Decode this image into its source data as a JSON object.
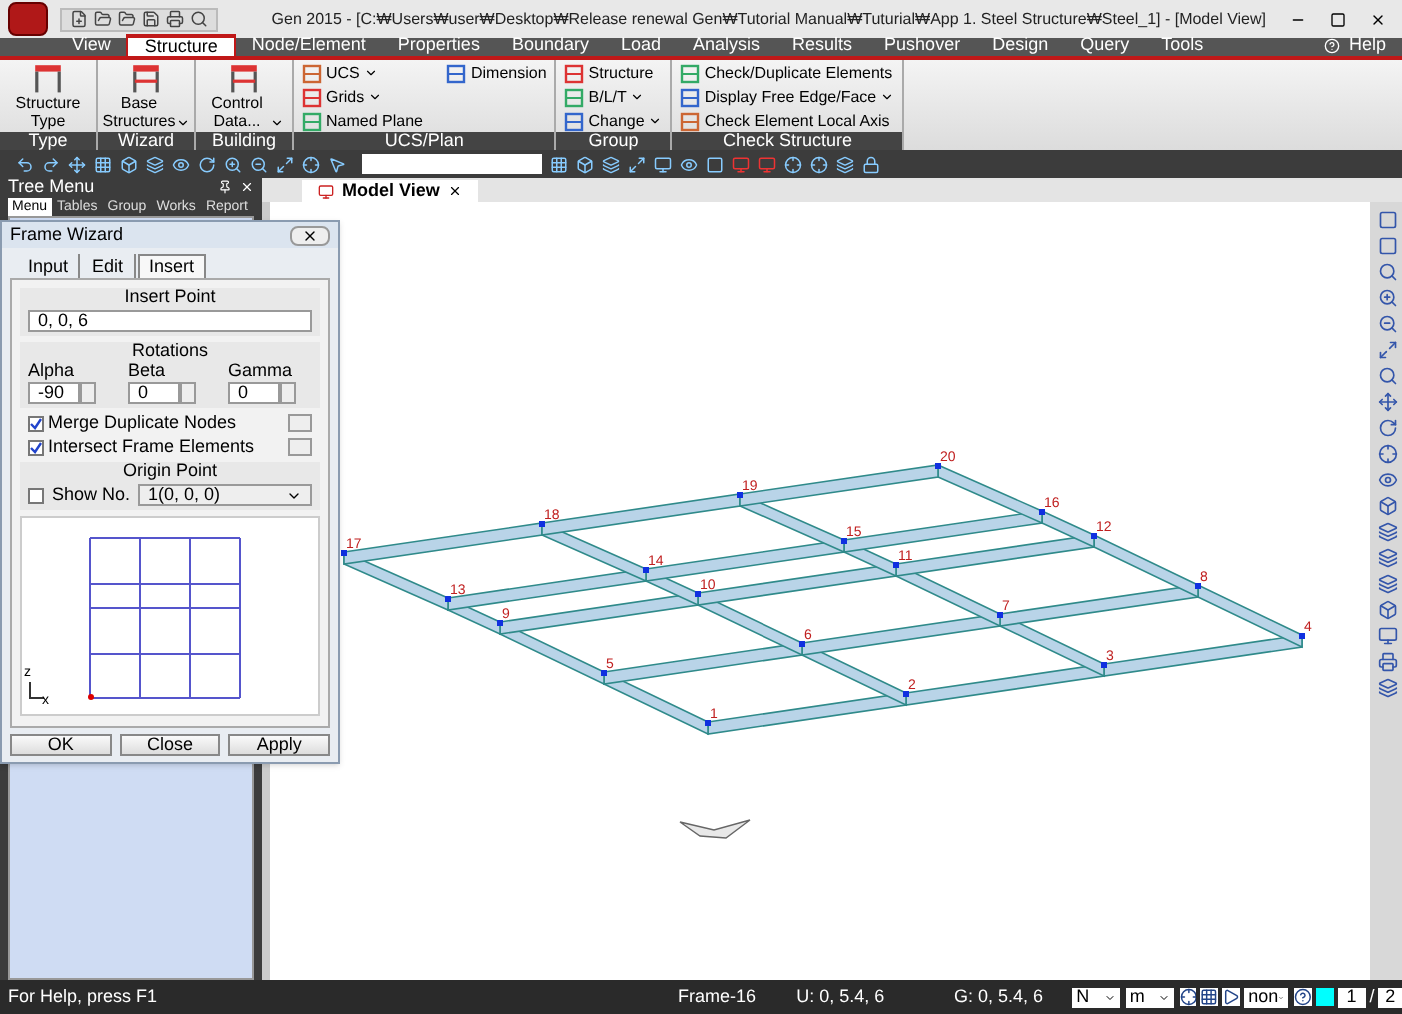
{
  "window": {
    "title": "Gen 2015 - [C:₩Users₩user₩Desktop₩Release renewal Gen₩Tutorial Manual₩Tuturial₩App 1. Steel Structure₩Steel_1] - [Model View]"
  },
  "menu_tabs": [
    {
      "label": "View",
      "selected": false
    },
    {
      "label": "Structure",
      "selected": true
    },
    {
      "label": "Node/Element",
      "selected": false
    },
    {
      "label": "Properties",
      "selected": false
    },
    {
      "label": "Boundary",
      "selected": false
    },
    {
      "label": "Load",
      "selected": false
    },
    {
      "label": "Analysis",
      "selected": false
    },
    {
      "label": "Results",
      "selected": false
    },
    {
      "label": "Pushover",
      "selected": false
    },
    {
      "label": "Design",
      "selected": false
    },
    {
      "label": "Query",
      "selected": false
    },
    {
      "label": "Tools",
      "selected": false
    }
  ],
  "help": "Help",
  "ribbon_groups": [
    {
      "title": "Type",
      "items": [
        {
          "kind": "large",
          "label": "Structure Type",
          "dropdown": false
        }
      ]
    },
    {
      "title": "Wizard",
      "items": [
        {
          "kind": "large",
          "label": "Base Structures",
          "dropdown": true
        }
      ]
    },
    {
      "title": "Building",
      "items": [
        {
          "kind": "large",
          "label": "Control Data...",
          "dropdown": true
        }
      ]
    },
    {
      "title": "UCS/Plan",
      "items": [
        {
          "kind": "small",
          "label": "UCS",
          "dropdown": true
        },
        {
          "kind": "small",
          "label": "Grids",
          "dropdown": true
        },
        {
          "kind": "small",
          "label": "Named Plane",
          "dropdown": false
        },
        {
          "kind": "small",
          "label": "Dimension",
          "dropdown": false
        }
      ]
    },
    {
      "title": "Group",
      "items": [
        {
          "kind": "small",
          "label": "Structure",
          "dropdown": false
        },
        {
          "kind": "small",
          "label": "B/L/T",
          "dropdown": true
        },
        {
          "kind": "small",
          "label": "Change",
          "dropdown": true
        }
      ]
    },
    {
      "title": "Check Structure",
      "items": [
        {
          "kind": "small",
          "label": "Check/Duplicate Elements",
          "dropdown": false
        },
        {
          "kind": "small",
          "label": "Display Free Edge/Face",
          "dropdown": true
        },
        {
          "kind": "small",
          "label": "Check Element Local Axis",
          "dropdown": false
        }
      ]
    }
  ],
  "tree_menu": {
    "title": "Tree Menu",
    "tabs": [
      {
        "label": "Menu",
        "selected": true
      },
      {
        "label": "Tables",
        "selected": false
      },
      {
        "label": "Group",
        "selected": false
      },
      {
        "label": "Works",
        "selected": false
      },
      {
        "label": "Report",
        "selected": false
      }
    ]
  },
  "model_view": {
    "tab": "Model View",
    "node_rows": [
      [
        "1",
        "2",
        "3",
        "4"
      ],
      [
        "5",
        "6",
        "7",
        "8"
      ],
      [
        "9",
        "10",
        "11",
        "12"
      ],
      [
        "13",
        "14",
        "15",
        "16"
      ],
      [
        "17",
        "18",
        "19",
        "20"
      ]
    ]
  },
  "frame_wizard": {
    "title": "Frame Wizard",
    "tabs": [
      {
        "label": "Input",
        "selected": false
      },
      {
        "label": "Edit",
        "selected": false
      },
      {
        "label": "Insert",
        "selected": true
      }
    ],
    "insert_point": {
      "label": "Insert Point",
      "value": "0, 0, 6"
    },
    "rotations": {
      "label": "Rotations",
      "fields": [
        {
          "label": "Alpha",
          "value": "-90"
        },
        {
          "label": "Beta",
          "value": "0"
        },
        {
          "label": "Gamma",
          "value": "0"
        }
      ]
    },
    "options": [
      {
        "label": "Merge Duplicate Nodes",
        "checked": true
      },
      {
        "label": "Intersect Frame Elements",
        "checked": true
      }
    ],
    "origin_point": {
      "label": "Origin Point",
      "show_no": {
        "label": "Show No.",
        "checked": false
      },
      "value": "1(0, 0, 0)"
    },
    "preview_axes": {
      "vertical": "z",
      "horizontal": "x"
    },
    "buttons": [
      "OK",
      "Close",
      "Apply"
    ]
  },
  "status_bar": {
    "help": "For Help, press F1",
    "selection": "Frame-16",
    "ucs": "U: 0, 5.4, 6",
    "global": "G: 0, 5.4, 6",
    "force_unit": "N",
    "length_unit": "m",
    "snap": "non",
    "page_current": "1",
    "page_separator": "/",
    "page_total": "2"
  }
}
